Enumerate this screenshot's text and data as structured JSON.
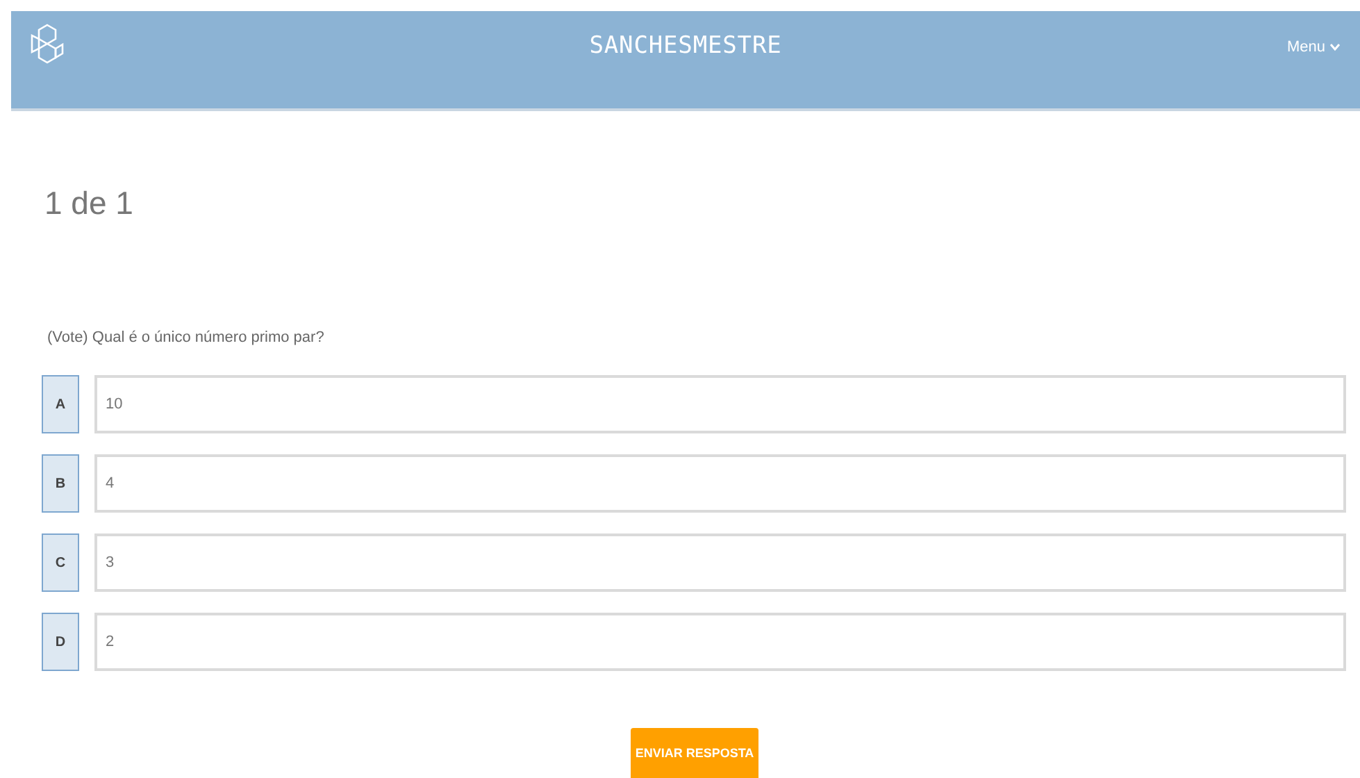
{
  "header": {
    "title": "SANCHESMESTRE",
    "menu": "Menu"
  },
  "progress": "1 de 1",
  "question": "(Vote) Qual é o único número primo par?",
  "options": [
    {
      "letter": "A",
      "value": "10"
    },
    {
      "letter": "B",
      "value": "4"
    },
    {
      "letter": "C",
      "value": "3"
    },
    {
      "letter": "D",
      "value": "2"
    }
  ],
  "submit_button": "ENVIAR RESPOSTA"
}
